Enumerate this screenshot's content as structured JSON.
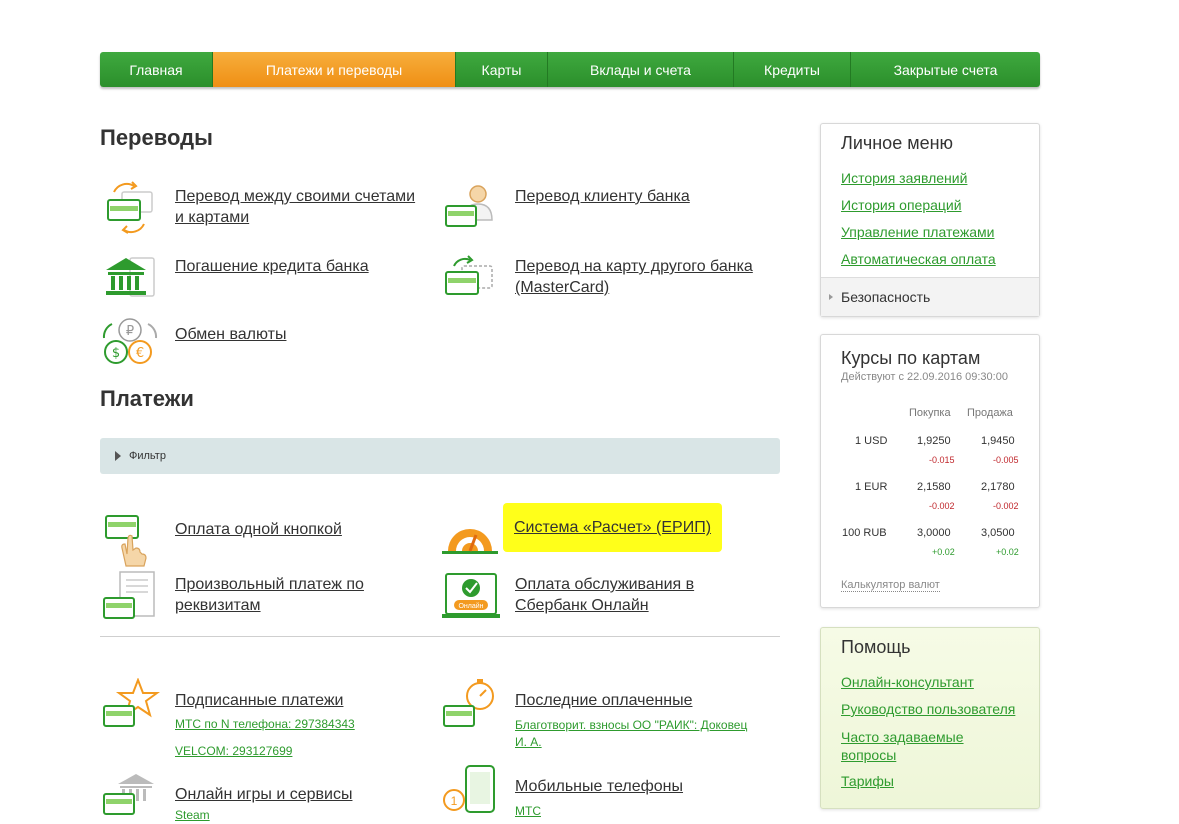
{
  "nav": {
    "items": [
      "Главная",
      "Платежи и переводы",
      "Карты",
      "Вклады и счета",
      "Кредиты",
      "Закрытые счета"
    ]
  },
  "transfers": {
    "title": "Переводы",
    "own_accounts": "Перевод между своими счетами и картами",
    "bank_client": "Перевод клиенту банка",
    "loan_repay": "Погашение кредита банка",
    "other_card": "Перевод на карту другого банка (MasterCard)",
    "currency": "Обмен валюты"
  },
  "payments": {
    "title": "Платежи",
    "filter": "Фильтр",
    "one_button": "Оплата одной кнопкой",
    "erip": "Система «Расчет» (ЕРИП)",
    "arbitrary": "Произвольный платеж по реквизитам",
    "sbol": "Оплата обслуживания в Сбербанк Онлайн",
    "online_badge": "Онлайн",
    "signed": "Подписанные платежи",
    "signed_sub1": "МТС по N телефона: 297384343",
    "signed_sub2": "VELCOM: 293127699",
    "last_paid": "Последние оплаченные",
    "last_paid_sub": "Благотворит. взносы ОО \"РАИК\": Доковец И. А.",
    "games": "Онлайн игры и сервисы",
    "games_sub": "Steam",
    "mobile": "Мобильные телефоны",
    "mobile_sub": "МТС",
    "mobile_badge": "1"
  },
  "personal_menu": {
    "title": "Личное меню",
    "links": [
      "История заявлений",
      "История операций",
      "Управление платежами",
      "Автоматическая оплата"
    ],
    "security": "Безопасность"
  },
  "rates": {
    "title": "Курсы по картам",
    "valid_from": "Действуют с 22.09.2016 09:30:00",
    "col_buy": "Покупка",
    "col_sell": "Продажа",
    "rows": [
      {
        "cur": "1 USD",
        "buy": "1,9250",
        "sell": "1,9450",
        "buy_chg": "-0.015",
        "sell_chg": "-0.005"
      },
      {
        "cur": "1 EUR",
        "buy": "2,1580",
        "sell": "2,1780",
        "buy_chg": "-0.002",
        "sell_chg": "-0.002"
      },
      {
        "cur": "100 RUB",
        "buy": "3,0000",
        "sell": "3,0500",
        "buy_chg": "+0.02",
        "sell_chg": "+0.02"
      }
    ],
    "calculator": "Калькулятор валют"
  },
  "help": {
    "title": "Помощь",
    "links": [
      "Онлайн-консультант",
      "Руководство пользователя",
      "Часто задаваемые вопросы",
      "Тарифы"
    ]
  },
  "colors": {
    "brand_green": "#2e9b2e",
    "active_orange": "#f39a1f",
    "highlight_yellow": "#ffff1a",
    "negative_red": "#c0282d"
  }
}
